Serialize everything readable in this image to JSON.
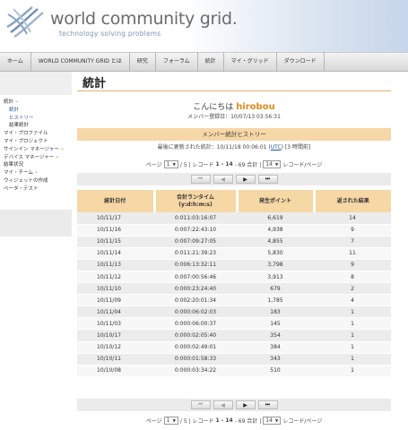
{
  "brand": {
    "title": "world community grid.",
    "tagline": "technology solving problems",
    "colors": {
      "gray": "#6b6b6b",
      "blue": "#7f95b5",
      "accent": "#e08a1e",
      "band": "#f6d7a6"
    }
  },
  "nav": [
    "ホーム",
    "WORLD COMMUNITY GRID とは",
    "研究",
    "フォーラム",
    "統計",
    "マイ・グリッド",
    "ダウンロード"
  ],
  "sidebar": {
    "items": [
      {
        "label": "統計",
        "arrow": "»",
        "level": 0
      },
      {
        "label": "統計",
        "level": 1
      },
      {
        "label": "ヒストリー",
        "level": 1
      },
      {
        "label": "結果統計",
        "level": 2
      },
      {
        "label": "マイ・プロファイル",
        "level": 0
      },
      {
        "label": "マイ・プロジェクト",
        "level": 0
      },
      {
        "label": "サインイン マネージャー",
        "arrow": "»",
        "level": 0
      },
      {
        "label": "デバイス マネージャー",
        "arrow": "»",
        "level": 0
      },
      {
        "label": "結果状況",
        "level": 0
      },
      {
        "label": "マイ・チーム",
        "arrow": "»",
        "level": 0
      },
      {
        "label": "ウィジェットの作成",
        "level": 0
      },
      {
        "label": "ベータ・テスト",
        "level": 0
      }
    ]
  },
  "page": {
    "title": "統計",
    "greeting_prefix": "こんにちは",
    "username": "hirobou",
    "member_since": "メンバー登録日：10/07/13 03:56:31",
    "section_title": "メンバー統計ヒストリー",
    "last_update_prefix": "最後に更新された統計：10/11/18 00:06:01 (",
    "last_update_link": "UTC",
    "last_update_suffix": ") [3 時間前]"
  },
  "pager": {
    "page_label": "ページ",
    "page_value": "1",
    "page_total": "/ 5 | レコード",
    "record_range": "1 - 14",
    "record_total": "- 69 合計 |",
    "per_page_value": "14",
    "per_page_label": "レコード/ページ"
  },
  "toolbar": {
    "first": "⏮",
    "prev": "◀",
    "next": "▶",
    "last": "⏭"
  },
  "table": {
    "headers": [
      "統計日付",
      "合計ランタイム\n(y:d:h:m:s)",
      "発生ポイント",
      "返された結果"
    ],
    "rows": [
      [
        "10/11/17",
        "0:011:03:16:07",
        "6,619",
        "14"
      ],
      [
        "10/11/16",
        "0:007:22:43:10",
        "4,938",
        "9"
      ],
      [
        "10/11/15",
        "0:007:09:27:05",
        "4,855",
        "7"
      ],
      [
        "10/11/14",
        "0:011:21:39:23",
        "5,830",
        "11"
      ],
      [
        "10/11/13",
        "0:006:13:32:11",
        "3,798",
        "9"
      ],
      [
        "10/11/12",
        "0:007:00:56:46",
        "3,913",
        "8"
      ],
      [
        "10/11/10",
        "0:000:23:24:40",
        "679",
        "2"
      ],
      [
        "10/11/09",
        "0:002:20:01:34",
        "1,785",
        "4"
      ],
      [
        "10/11/04",
        "0:000:06:02:03",
        "183",
        "1"
      ],
      [
        "10/11/03",
        "0:000:06:00:37",
        "145",
        "1"
      ],
      [
        "10/10/17",
        "0:000:02:05:40",
        "354",
        "1"
      ],
      [
        "10/10/12",
        "0:000:02:49:01",
        "384",
        "1"
      ],
      [
        "10/10/11",
        "0:000:01:58:33",
        "343",
        "1"
      ],
      [
        "10/10/08",
        "0:000:03:34:22",
        "510",
        "1"
      ]
    ]
  }
}
